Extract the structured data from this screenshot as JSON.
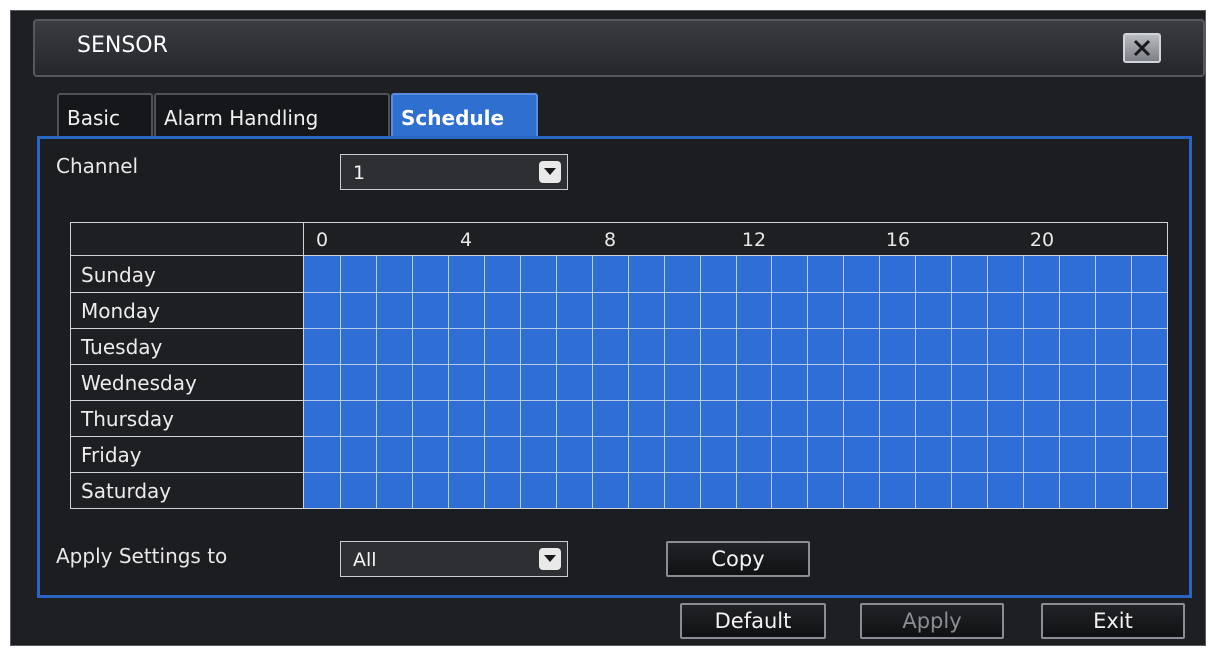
{
  "window": {
    "title": "SENSOR"
  },
  "tabs": [
    {
      "label": "Basic",
      "active": false
    },
    {
      "label": "Alarm Handling",
      "active": false
    },
    {
      "label": "Schedule",
      "active": true
    }
  ],
  "channel": {
    "label": "Channel",
    "value": "1"
  },
  "schedule": {
    "hour_labels": [
      "0",
      "4",
      "8",
      "12",
      "16",
      "20"
    ],
    "days": [
      "Sunday",
      "Monday",
      "Tuesday",
      "Wednesday",
      "Thursday",
      "Friday",
      "Saturday"
    ],
    "cells_per_day": 24,
    "all_selected": true,
    "selected_color": "#2f6fd5"
  },
  "apply_settings": {
    "label": "Apply Settings to",
    "value": "All"
  },
  "buttons": {
    "copy": "Copy",
    "default": "Default",
    "apply": "Apply",
    "exit": "Exit"
  },
  "icons": {
    "close": "close-icon",
    "dropdown": "chevron-down-icon"
  },
  "colors": {
    "accent": "#2b65c4",
    "background": "#1e1f22"
  }
}
